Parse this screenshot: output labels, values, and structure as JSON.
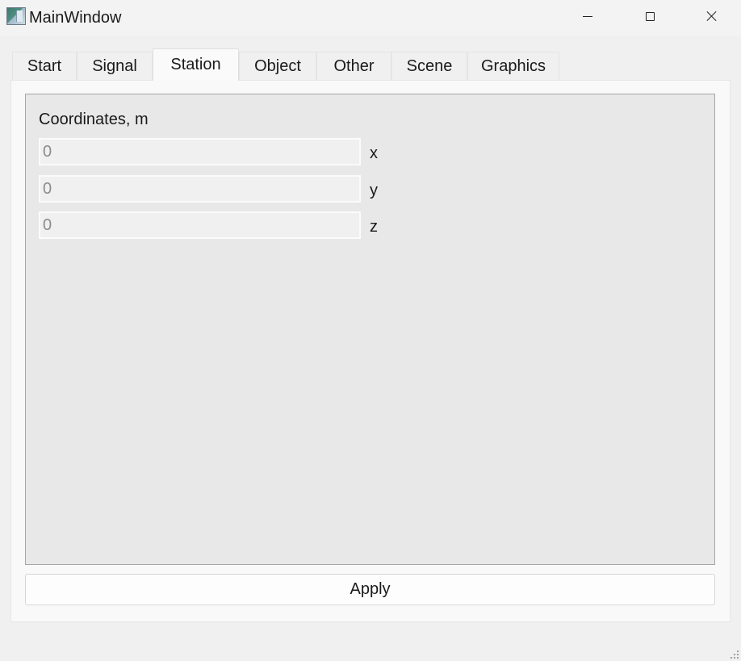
{
  "window": {
    "title": "MainWindow"
  },
  "tabs": [
    {
      "label": "Start",
      "active": false
    },
    {
      "label": "Signal",
      "active": false
    },
    {
      "label": "Station",
      "active": true
    },
    {
      "label": "Object",
      "active": false
    },
    {
      "label": "Other",
      "active": false
    },
    {
      "label": "Scene",
      "active": false
    },
    {
      "label": "Graphics",
      "active": false
    }
  ],
  "station": {
    "coordinates_label": "Coordinates, m",
    "fields": [
      {
        "axis": "x",
        "value": "",
        "placeholder": "0"
      },
      {
        "axis": "y",
        "value": "",
        "placeholder": "0"
      },
      {
        "axis": "z",
        "value": "",
        "placeholder": "0"
      }
    ],
    "apply_label": "Apply"
  },
  "icons": {
    "app": "app-window-icon",
    "minimize": "minimize-icon",
    "maximize": "maximize-icon",
    "close": "close-icon",
    "resize": "resize-grip-icon"
  }
}
